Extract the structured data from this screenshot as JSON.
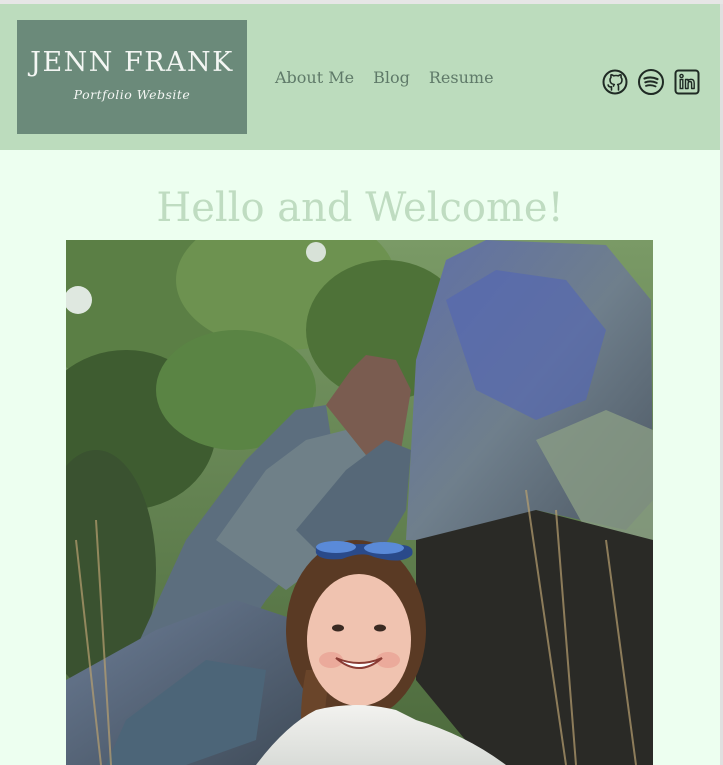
{
  "brand": {
    "title": "JENN FRANK",
    "subtitle": "Portfolio Website"
  },
  "nav": {
    "items": [
      {
        "label": "About Me"
      },
      {
        "label": "Blog"
      },
      {
        "label": "Resume"
      }
    ]
  },
  "social": [
    {
      "icon": "github-icon"
    },
    {
      "icon": "spotify-icon"
    },
    {
      "icon": "linkedin-icon"
    }
  ],
  "main": {
    "heading": "Hello and Welcome!",
    "photo_alt": "Photo of Jenn Frank smiling in front of large rocks and greenery"
  },
  "colors": {
    "page_bg": "#edfff0",
    "header_bg": "#bcdcbd",
    "logo_bg": "#6b8a7a",
    "heading": "#bfdcc1",
    "nav_text": "#5f7a69"
  }
}
